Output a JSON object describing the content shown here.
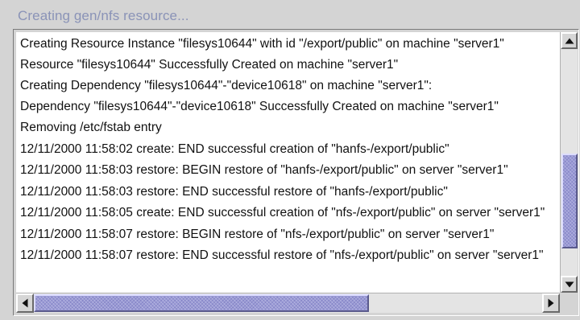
{
  "panel": {
    "title": "Creating gen/nfs resource..."
  },
  "log": {
    "lines": [
      "Creating Resource Instance \"filesys10644\" with id \"/export/public\" on machine \"server1\"",
      "Resource \"filesys10644\" Successfully Created on machine \"server1\"",
      "Creating Dependency \"filesys10644\"-\"device10618\" on machine \"server1\":",
      "Dependency \"filesys10644\"-\"device10618\" Successfully Created on machine \"server1\"",
      "Removing /etc/fstab entry",
      "12/11/2000 11:58:02 create: END successful creation of \"hanfs-/export/public\"",
      "12/11/2000 11:58:03 restore: BEGIN restore of \"hanfs-/export/public\" on server \"server1\"",
      "12/11/2000 11:58:03 restore: END successful restore of \"hanfs-/export/public\"",
      "12/11/2000 11:58:05 create: END successful creation of \"nfs-/export/public\" on server \"server1\"",
      "12/11/2000 11:58:07 restore: BEGIN restore of \"nfs-/export/public\" on server \"server1\"",
      "12/11/2000 11:58:07 restore: END successful restore of \"nfs-/export/public\" on server \"server1\""
    ]
  },
  "scrollbars": {
    "vertical": {
      "thumb_start": 0.46,
      "thumb_end": 0.88
    },
    "horizontal": {
      "thumb_start": 0.0,
      "thumb_end": 0.66
    },
    "thumb_color": "#9a9ad6",
    "icons": {
      "up": "arrow-up-icon",
      "down": "arrow-down-icon",
      "left": "arrow-left-icon",
      "right": "arrow-right-icon"
    }
  }
}
